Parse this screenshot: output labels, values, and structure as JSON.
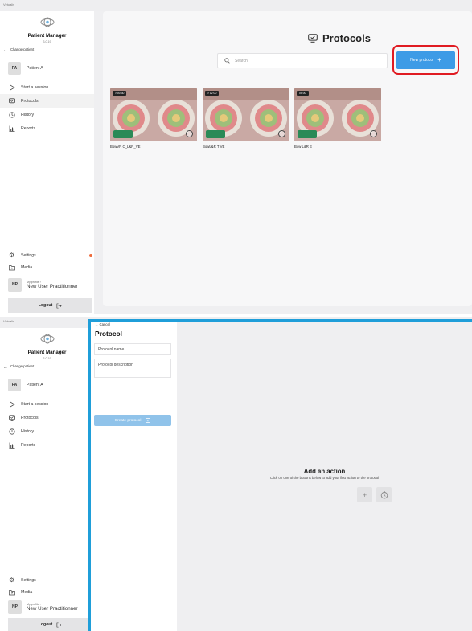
{
  "app": {
    "titlebar": "Virtualis",
    "name": "Patient Manager",
    "version": "3.0.19"
  },
  "sidebar": {
    "change_patient": "Change patient",
    "patient": {
      "initials": "PA",
      "name": "Patient A"
    },
    "nav": [
      {
        "label": "Start a session",
        "icon": "play-outline-icon"
      },
      {
        "label": "Protocols",
        "icon": "protocol-screen-icon"
      },
      {
        "label": "History",
        "icon": "history-icon"
      },
      {
        "label": "Reports",
        "icon": "bar-chart-icon"
      }
    ],
    "settings": "Settings",
    "media": "Media",
    "profile": {
      "initials": "NP",
      "caption": "My profile ›",
      "name": "New User Practitionner"
    },
    "logout": "Logout"
  },
  "protocols_page": {
    "title": "Protocols",
    "search_placeholder": "Search",
    "new_button": "New protocol",
    "cards": [
      {
        "duration": "> 00:30",
        "name": "BowVR C_L&R_VE"
      },
      {
        "duration": "> 12:00",
        "name": "BowL&R T VE"
      },
      {
        "duration": "05:00",
        "name": "Bow L&R E"
      }
    ]
  },
  "create_page": {
    "cancel": "Cancel",
    "title": "Protocol",
    "name_field": "Protocol name",
    "description_field": "Protocol description",
    "create_button": "Create protocol",
    "empty_title": "Add an action",
    "empty_text": "Click on one of the buttons below to add your first action to the protocol"
  },
  "colors": {
    "accent": "#3d9be6",
    "highlight": "#e01b22",
    "panel_border": "#1f9ed9",
    "notification": "#ee6a3a"
  }
}
